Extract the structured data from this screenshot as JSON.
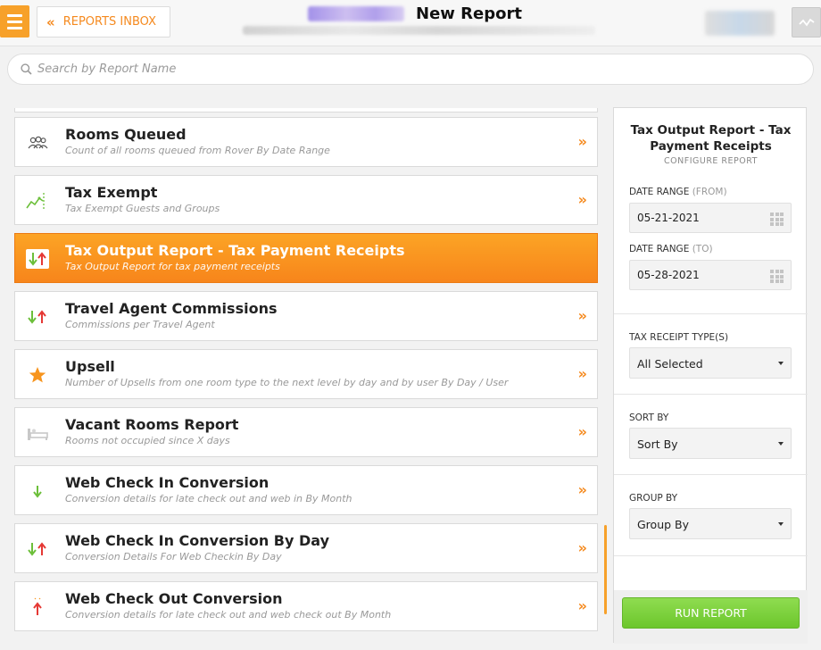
{
  "header": {
    "back_label": "REPORTS INBOX",
    "title": "New Report"
  },
  "search": {
    "placeholder": "Search by Report Name"
  },
  "reports": [
    {
      "name": "Rooms Queued",
      "description": "Count of all rooms queued from Rover By Date Range",
      "icon": "users-icon"
    },
    {
      "name": "Tax Exempt",
      "description": "Tax Exempt Guests and Groups",
      "icon": "trend-chart-icon"
    },
    {
      "name": "Tax Output Report - Tax Payment Receipts",
      "description": "Tax Output Report for tax payment receipts",
      "icon": "up-down-arrows-icon",
      "selected": true
    },
    {
      "name": "Travel Agent Commissions",
      "description": "Commissions per Travel Agent",
      "icon": "up-down-arrows-icon"
    },
    {
      "name": "Upsell",
      "description": "Number of Upsells from one room type to the next level by day and by user By Day / User",
      "icon": "star-icon"
    },
    {
      "name": "Vacant Rooms Report",
      "description": "Rooms not occupied since X days",
      "icon": "bed-icon"
    },
    {
      "name": "Web Check In Conversion",
      "description": "Conversion details for late check out and web in By Month",
      "icon": "down-arrow-icon"
    },
    {
      "name": "Web Check In Conversion By Day",
      "description": "Conversion Details For Web Checkin By Day",
      "icon": "up-down-arrows-icon"
    },
    {
      "name": "Web Check Out Conversion",
      "description": "Conversion details for late check out and web check out By Month",
      "icon": "up-arrow-icon"
    }
  ],
  "config": {
    "title": "Tax Output Report - Tax Payment Receipts",
    "subtitle": "CONFIGURE REPORT",
    "date_from_label": "DATE RANGE",
    "date_from_suffix": "(FROM)",
    "date_from_value": "05-21-2021",
    "date_to_label": "DATE RANGE",
    "date_to_suffix": "(TO)",
    "date_to_value": "05-28-2021",
    "tax_receipt_label": "TAX RECEIPT TYPE(S)",
    "tax_receipt_value": "All Selected",
    "sort_label": "SORT BY",
    "sort_value": "Sort By",
    "group_label": "GROUP BY",
    "group_value": "Group By",
    "run_label": "RUN REPORT"
  },
  "colors": {
    "accent": "#f58a1f",
    "selected_gradient_top": "#fca425",
    "selected_gradient_bottom": "#f7851b",
    "run_button": "#76cc35",
    "arrow_up": "#e53935",
    "arrow_down": "#6cbf3a"
  }
}
